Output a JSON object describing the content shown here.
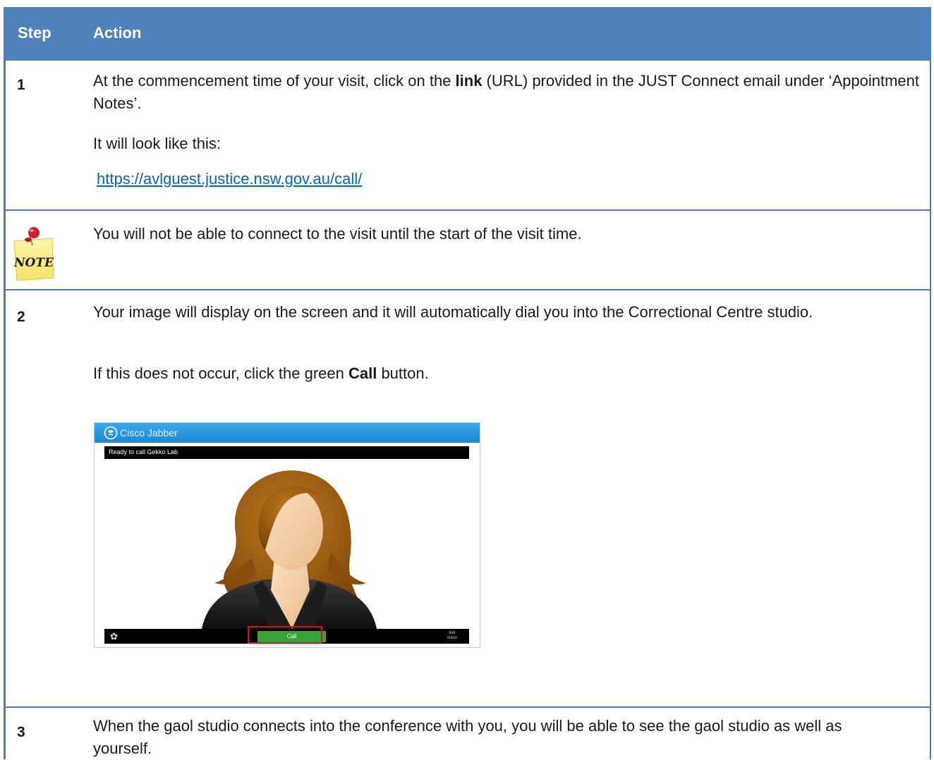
{
  "header": {
    "step_label": "Step",
    "action_label": "Action"
  },
  "rows": [
    {
      "step": "1",
      "text_before": "At the commencement time of your visit, click on the ",
      "text_bold": "link",
      "text_after": " (URL) provided in the JUST Connect email under ‘Appointment Notes’.",
      "line2": "It will look like this:",
      "url": "https://avlguest.justice.nsw.gov.au/call/"
    },
    {
      "note_icon_label": "NOTE",
      "note_text": "You will not be able to connect to the visit until the start of the visit time."
    },
    {
      "step": "2",
      "para1": "Your image will display on the screen and it will automatically dial you into the Correctional Centre studio.",
      "para2_before": "If this does not occur, click the green ",
      "para2_bold": "Call",
      "para2_after": " button."
    },
    {
      "step": "3",
      "text": "When the gaol studio connects into the conference with you, you will be able to see the gaol studio as well as yourself."
    }
  ],
  "jabber": {
    "title": "Cisco Jabber",
    "status": "Ready to call Gekko Lab",
    "call_label": "Call",
    "cisco_logo": "cisco"
  },
  "colors": {
    "header_bg": "#4f81bd",
    "link": "#0563c1",
    "call_green": "#3aa23a",
    "highlight_red": "#d0121b"
  }
}
